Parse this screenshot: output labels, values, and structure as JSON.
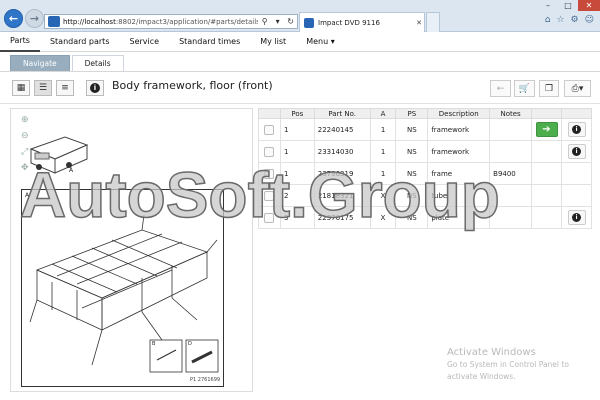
{
  "browser": {
    "address_host": "http://localhost",
    "address_rest": ":8802/impact3/application/#parts/details/services",
    "tab_title": "Impact DVD 9116"
  },
  "menu": {
    "items": [
      "Parts",
      "Standard parts",
      "Service",
      "Standard times",
      "My list",
      "Menu ▾"
    ]
  },
  "subtabs": {
    "navigate": "Navigate",
    "details": "Details"
  },
  "page_title": "Body framework, floor (front)",
  "parts_table": {
    "headers": [
      "",
      "Pos",
      "Part No.",
      "A",
      "PS",
      "Description",
      "Notes",
      "",
      ""
    ],
    "rows": [
      {
        "pos": "1",
        "part_no": "22240145",
        "a": "1",
        "ps": "NS",
        "description": "framework",
        "notes": ""
      },
      {
        "pos": "1",
        "part_no": "23314030",
        "a": "1",
        "ps": "NS",
        "description": "framework",
        "notes": ""
      },
      {
        "pos": "1",
        "part_no": "23796319",
        "a": "1",
        "ps": "NS",
        "description": "frame",
        "notes": "B9400"
      },
      {
        "pos": "2",
        "part_no": "21818321",
        "a": "X",
        "ps": "NS",
        "description": "tube",
        "notes": ""
      },
      {
        "pos": "3",
        "part_no": "22376175",
        "a": "X",
        "ps": "NS",
        "description": "plate",
        "notes": ""
      }
    ]
  },
  "drawing": {
    "label_a": "A",
    "label_b": "B",
    "label_d": "D",
    "ref": "P1 2761699"
  },
  "watermark": "AutoSoft.Group",
  "activation": {
    "title": "Activate Windows",
    "line1": "Go to System in Control Panel to",
    "line2": "activate Windows."
  },
  "colors": {
    "accent": "#2f76c9",
    "go_button": "#4cae4c",
    "selected_subtab": "#98aebf"
  }
}
